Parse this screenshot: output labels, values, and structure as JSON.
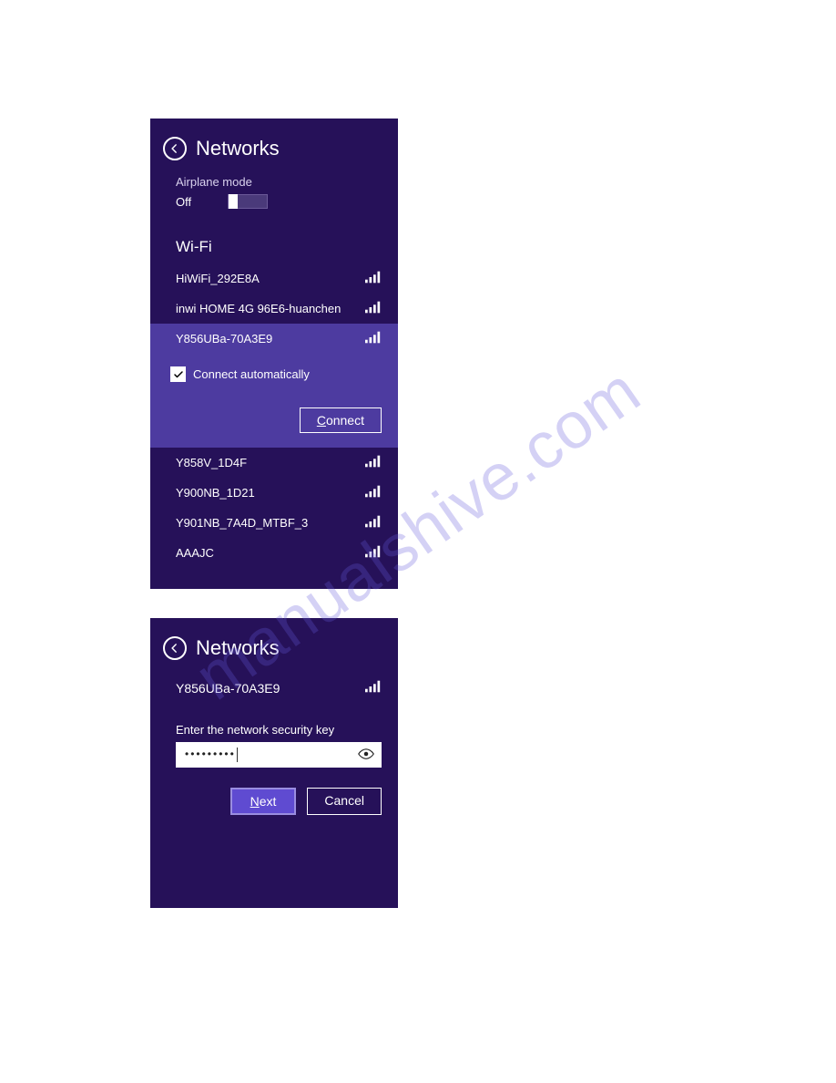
{
  "watermark": "manualshive.com",
  "panel1": {
    "title": "Networks",
    "airplane": {
      "label": "Airplane mode",
      "state": "Off"
    },
    "wifi_heading": "Wi-Fi",
    "selected_index": 2,
    "connect_auto_label": "Connect automatically",
    "connect_auto_checked": true,
    "connect_label_u": "C",
    "connect_label_rest": "onnect",
    "networks": [
      {
        "name": "HiWiFi_292E8A"
      },
      {
        "name": "inwi HOME 4G 96E6-huanchen"
      },
      {
        "name": "Y856UBa-70A3E9"
      },
      {
        "name": "Y858V_1D4F"
      },
      {
        "name": "Y900NB_1D21"
      },
      {
        "name": "Y901NB_7A4D_MTBF_3"
      },
      {
        "name": "AAAJC"
      }
    ]
  },
  "panel2": {
    "title": "Networks",
    "network": "Y856UBa-70A3E9",
    "prompt": "Enter the network security key",
    "password_mask": "•••••••••",
    "next_u": "N",
    "next_rest": "ext",
    "cancel_label": "Cancel"
  }
}
